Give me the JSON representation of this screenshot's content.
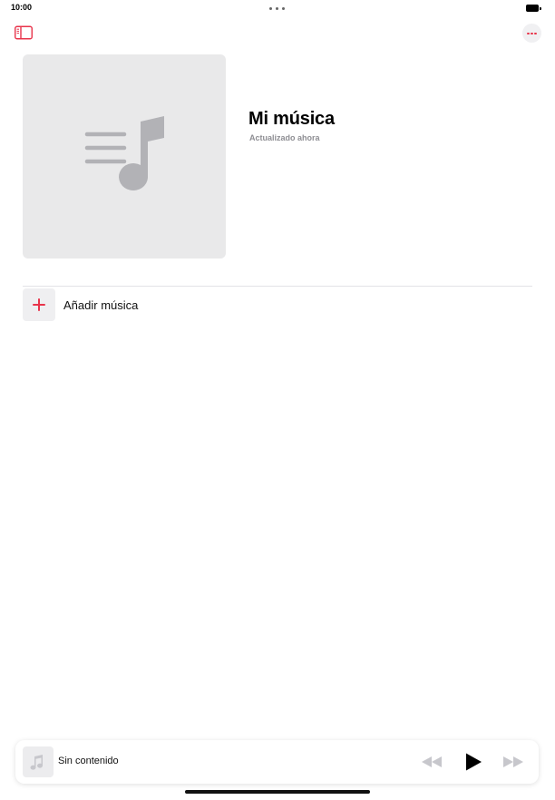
{
  "status_bar": {
    "time": "10:00",
    "icons": [
      "multitasking-dots-icon",
      "battery-icon"
    ]
  },
  "toolbar": {
    "sidebar_icon": "sidebar-toggle-icon",
    "more_icon": "ellipsis-icon"
  },
  "playlist": {
    "title": "Mi música",
    "subtitle": "Actualizado ahora",
    "artwork_icon": "music-note-list-icon"
  },
  "list": {
    "add_label": "Añadir música",
    "add_icon": "plus-icon"
  },
  "mini_player": {
    "title": "Sin contenido",
    "artwork_icon": "music-note-icon",
    "controls": [
      "rewind-icon",
      "play-icon",
      "fast-forward-icon"
    ]
  },
  "colors": {
    "accent": "#e8344b",
    "artwork_bg": "#e9e9ea",
    "secondary_text": "#8e8e93",
    "disabled_control": "#c7c7cc"
  }
}
